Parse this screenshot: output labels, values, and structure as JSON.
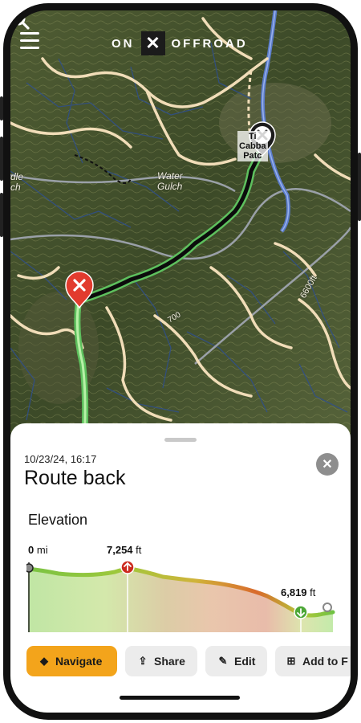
{
  "header": {
    "logo_left": "ON",
    "logo_mark": "✕",
    "logo_right": "OFFROAD",
    "menu_icon": "hamburger-menu-icon",
    "search_icon": "search-icon"
  },
  "map": {
    "labels": {
      "water_gulch_1": "Water",
      "water_gulch_2": "Gulch",
      "poi_1": "Ti",
      "poi_2": "Cabba",
      "poi_3": "Patc",
      "partial_left_1": "dle",
      "partial_left_2": "ch",
      "contour": "6600ft",
      "road_number": "700"
    },
    "colors": {
      "trail": "#f1ddb8",
      "route": "#0c0c0c",
      "route_outline": "#5ec05e",
      "water": "#5a7bc9",
      "start_pin": "#e23b2e",
      "end_pin": "#1c1c1c"
    }
  },
  "sheet": {
    "timestamp": "10/23/24, 16:17",
    "title": "Route back",
    "close_icon": "close-icon",
    "elevation": {
      "heading": "Elevation",
      "start_distance": "0",
      "start_unit": "mi",
      "max_value": "7,254",
      "max_unit": "ft",
      "end_value": "6,819",
      "end_unit": "ft"
    },
    "actions": {
      "navigate": "Navigate",
      "share": "Share",
      "edit": "Edit",
      "add": "Add to F"
    }
  }
}
